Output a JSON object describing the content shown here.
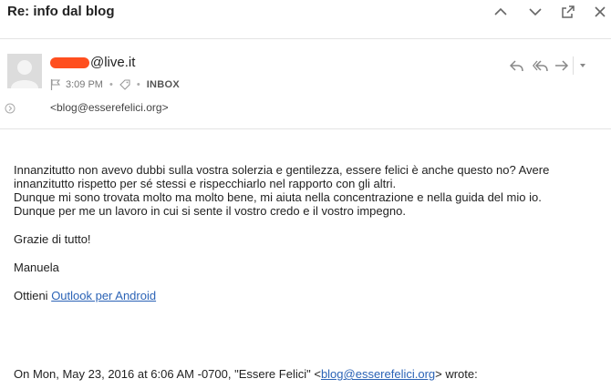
{
  "header": {
    "subject": "Re: info dal blog"
  },
  "message": {
    "sender_domain": "@live.it",
    "time": "3:09 PM",
    "folder": "INBOX",
    "recipient": "<blog@esserefelici.org>"
  },
  "body": {
    "paragraph1_line1": "Innanzitutto non avevo dubbi sulla vostra solerzia e gentilezza, essere felici è anche questo no? Avere",
    "paragraph1_line2": "innanzitutto rispetto per sé stessi e rispecchiarlo nel rapporto con gli altri.",
    "paragraph1_line3": "Dunque mi sono trovata molto ma molto bene, mi aiuta nella concentrazione e nella guida del mio io.",
    "paragraph1_line4": "Dunque per me un lavoro in cui si sente il vostro credo e il vostro impegno.",
    "thanks": "Grazie di tutto!",
    "signature": "Manuela",
    "get_prefix": "Ottieni ",
    "get_link": "Outlook per Android"
  },
  "quote": {
    "prefix": "On Mon, May 23, 2016 at 6:06 AM -0700, \"Essere Felici\" <",
    "email": "blog@esserefelici.org",
    "suffix": "> wrote:"
  },
  "icons": {
    "header": [
      "chevron-up-icon",
      "chevron-down-icon",
      "popout-icon",
      "close-icon"
    ],
    "actions": [
      "reply-icon",
      "reply-all-icon",
      "forward-icon",
      "more-dropdown-icon"
    ],
    "meta": [
      "flag-icon",
      "tag-icon"
    ]
  },
  "colors": {
    "link": "#2b63b6",
    "redaction": "#ff4f1f",
    "divider": "#e4e4e4"
  }
}
